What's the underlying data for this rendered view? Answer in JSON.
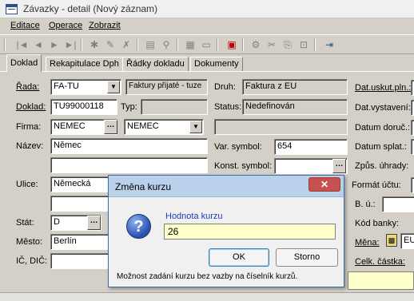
{
  "window": {
    "title": "Závazky - detail (Nový záznam)"
  },
  "menu": {
    "items": [
      "Editace",
      "Operace",
      "Zobrazit"
    ]
  },
  "tabs": [
    "Doklad",
    "Rekapitulace Dph",
    "Řádky dokladu",
    "Dokumenty"
  ],
  "form": {
    "rada_label": "Řada:",
    "rada_value": "FA-TU",
    "rada_desc": "Faktury přijaté - tuze",
    "doklad_label": "Doklad:",
    "doklad_value": "TU99000118",
    "typ_label": "Typ:",
    "firma_label": "Firma:",
    "firma_value": "NEMEC",
    "firma_combo_value": "NEMEC",
    "nazev_label": "Název:",
    "nazev_value": "Němec",
    "ulice_label": "Ulice:",
    "ulice_value": "Německá",
    "stat_label": "Stát:",
    "stat_value": "D",
    "mesto_label": "Město:",
    "mesto_value": "Berlín",
    "ic_dic_label": "IČ, DIČ:",
    "druh_label": "Druh:",
    "druh_value": "Faktura z EU",
    "status_label": "Status:",
    "status_value": "Nedefinován",
    "var_symbol_label": "Var. symbol:",
    "var_symbol_value": "654",
    "konst_symbol_label": "Konst. symbol:",
    "dat_uskut_label": "Dat.uskut.pln.:",
    "dat_vystaveni_label": "Dat.vystavení:",
    "datum_doruc_label": "Datum doruč.:",
    "datum_splat_label": "Datum splat.:",
    "zpusob_uhrady_label": "Způs. úhrady:",
    "format_uctu_label": "Formát účtu:",
    "bu_label": "B. ú.:",
    "kod_banky_label": "Kód banky:",
    "mena_label": "Měna:",
    "mena_value": "EU",
    "celk_castka_label": "Celk. částka:"
  },
  "dialog": {
    "title": "Změna kurzu",
    "close_glyph": "✕",
    "input_label": "Hodnota kurzu",
    "input_value": "26",
    "ok_label": "OK",
    "cancel_label": "Storno",
    "footer_text": "Možnost zadání kurzu bez vazby na číselník kurzů.",
    "icon": "question-icon"
  },
  "colors": {
    "dialog_title_bg": "#b9d1ea",
    "dialog_input_bg": "#ffffcc",
    "close_button_bg": "#c75050",
    "label_blue": "#1a3fb5",
    "window_bg": "#d4d0c8"
  }
}
